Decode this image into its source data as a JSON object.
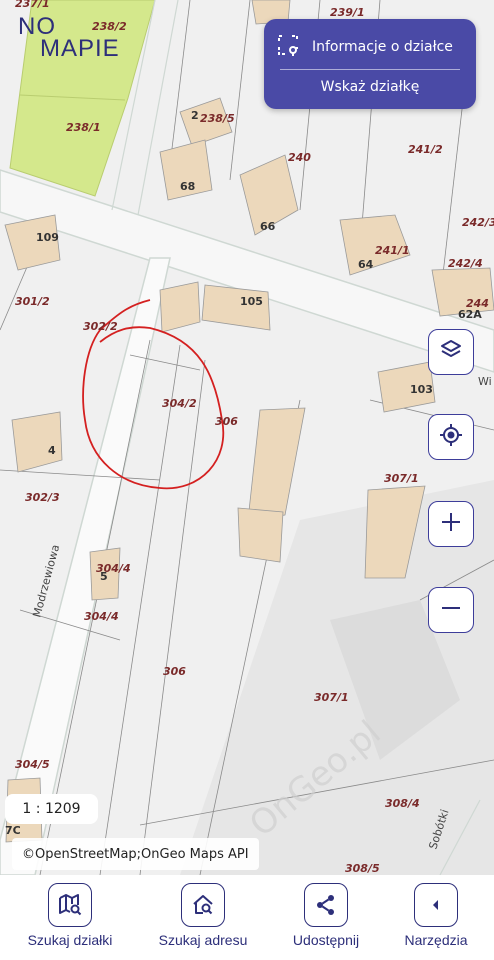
{
  "logo": {
    "line1": "NO",
    "line2": "MAPIE"
  },
  "panel": {
    "info_label": "Informacje o działce",
    "show_label": "Wskaż działkę"
  },
  "map_labels": {
    "p237_1": "237/1",
    "p238_2": "238/2",
    "p238_1": "238/1",
    "p239_1": "239/1",
    "p238_5": "238/5",
    "p240": "240",
    "p241_2": "241/2",
    "p241_1": "241/1",
    "p242_4": "242/4",
    "p244": "244",
    "p242_3": "242/3",
    "h2": "2",
    "h68": "68",
    "h66": "66",
    "h64": "64",
    "h109": "109",
    "h105": "105",
    "h62a": "62A",
    "p301_2": "301/2",
    "p302_2": "302/2",
    "p304_2": "304/2",
    "p306a": "306",
    "h103": "103",
    "h4": "4",
    "p302_3": "302/3",
    "p307_1a": "307/1",
    "p304_4a": "304/4",
    "h5": "5",
    "p304_4b": "304/4",
    "street_modrzewiowa": "Modrzewiowa",
    "p306b": "306",
    "p307_1b": "307/1",
    "p304_5": "304/5",
    "h7c": "7C",
    "p308_4": "308/4",
    "street_sobotki": "Sobótki",
    "p308_5": "308/5",
    "street_w": "Wi",
    "watermark": "OnGeo.pl"
  },
  "scale": "1 : 1209",
  "attribution": "©OpenStreetMap;OnGeo Maps API",
  "nav": [
    {
      "label": "Szukaj działki",
      "icon": "map-search-icon"
    },
    {
      "label": "Szukaj adresu",
      "icon": "home-search-icon"
    },
    {
      "label": "Udostępnij",
      "icon": "share-icon"
    },
    {
      "label": "Narzędzia",
      "icon": "chevron-left-icon"
    }
  ],
  "colors": {
    "brand": "#2d2f7a",
    "panel": "#4a4aa6",
    "highlight_parcel": "#d4e88c",
    "annotation": "#d42020",
    "building": "#ecd8bb"
  }
}
